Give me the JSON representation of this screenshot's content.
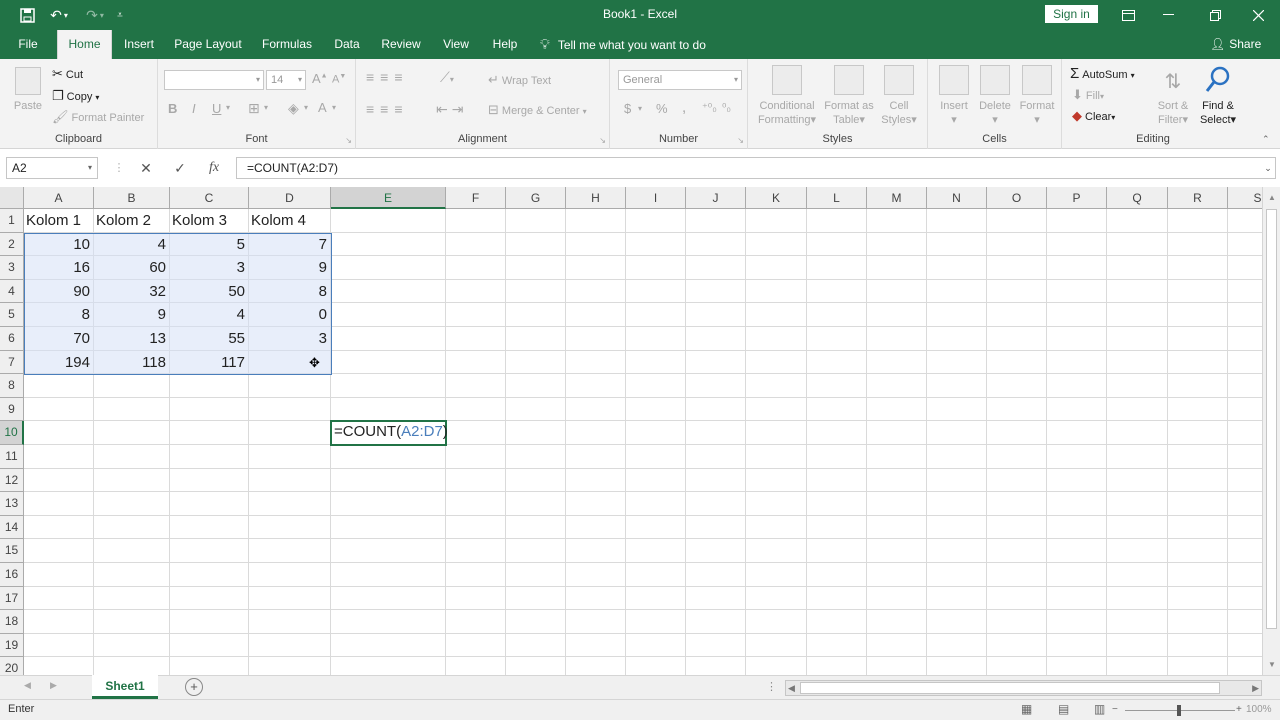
{
  "window": {
    "title": "Book1  -  Excel",
    "sign_in": "Sign in",
    "save_icon": "save-icon",
    "undo_icon": "undo-icon",
    "redo_icon": "redo-icon"
  },
  "tabs": {
    "items": [
      "File",
      "Home",
      "Insert",
      "Page Layout",
      "Formulas",
      "Data",
      "Review",
      "View",
      "Help"
    ],
    "tell_me": "Tell me what you want to do",
    "share": "Share",
    "active": "Home"
  },
  "ribbon": {
    "clipboard": {
      "paste": "Paste",
      "cut": "Cut",
      "copy": "Copy",
      "format_painter": "Format Painter",
      "label": "Clipboard"
    },
    "font": {
      "font_size": "14",
      "bold": "B",
      "italic": "I",
      "underline": "U",
      "label": "Font"
    },
    "alignment": {
      "wrap_text": "Wrap Text",
      "merge_center": "Merge & Center",
      "label": "Alignment"
    },
    "number": {
      "format": "General",
      "currency": "$",
      "percent": "%",
      "comma": ",",
      "label": "Number"
    },
    "styles": {
      "conditional_line1": "Conditional",
      "conditional_line2": "Formatting",
      "format_table_line1": "Format as",
      "format_table_line2": "Table",
      "cell_styles_line1": "Cell",
      "cell_styles_line2": "Styles",
      "label": "Styles"
    },
    "cells": {
      "insert": "Insert",
      "delete": "Delete",
      "format": "Format",
      "label": "Cells"
    },
    "editing": {
      "autosum": "AutoSum",
      "fill": "Fill",
      "clear": "Clear",
      "sort_line1": "Sort &",
      "sort_line2": "Filter",
      "find_line1": "Find &",
      "find_line2": "Select",
      "label": "Editing"
    }
  },
  "formula_bar": {
    "name_box": "A2",
    "cancel": "✕",
    "enter": "✓",
    "fx": "fx",
    "formula": "=COUNT(A2:D7)"
  },
  "sheet": {
    "columns": [
      "A",
      "B",
      "C",
      "D",
      "E",
      "F",
      "G",
      "H",
      "I",
      "J",
      "K",
      "L",
      "M",
      "N",
      "O",
      "P",
      "Q",
      "R",
      "S"
    ],
    "rows": [
      "1",
      "2",
      "3",
      "4",
      "5",
      "6",
      "7",
      "8",
      "9",
      "10",
      "11",
      "12",
      "13",
      "14",
      "15",
      "16",
      "17",
      "18",
      "19",
      "20"
    ],
    "headers": [
      "Kolom 1",
      "Kolom 2",
      "Kolom 3",
      "Kolom 4"
    ],
    "data": [
      [
        "10",
        "4",
        "5",
        "7"
      ],
      [
        "16",
        "60",
        "3",
        "9"
      ],
      [
        "90",
        "32",
        "50",
        "8"
      ],
      [
        "8",
        "9",
        "4",
        "0"
      ],
      [
        "70",
        "13",
        "55",
        "3"
      ],
      [
        "194",
        "118",
        "117",
        ""
      ]
    ],
    "edit_cell": {
      "prefix": "=COUNT(",
      "ref": "A2:D7",
      "suffix": ")"
    }
  },
  "sheet_tabs": {
    "active": "Sheet1",
    "add": "+"
  },
  "status": {
    "mode": "Enter",
    "zoom": "100%"
  }
}
